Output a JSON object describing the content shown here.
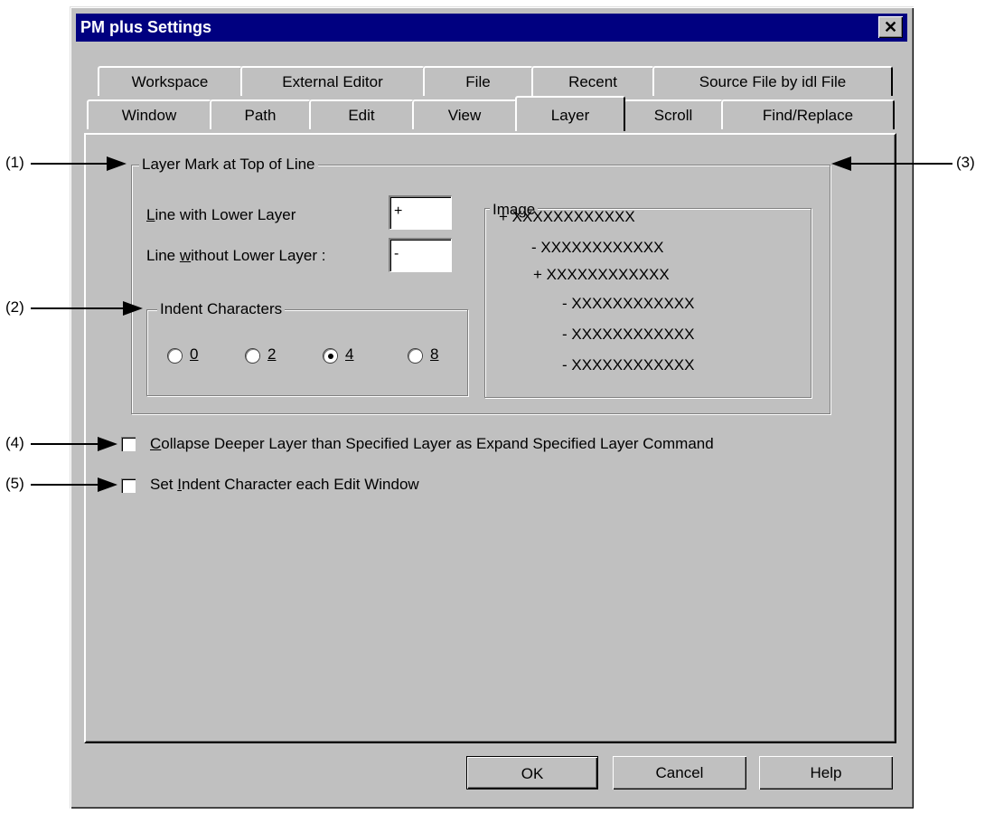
{
  "dialog": {
    "title": "PM plus Settings",
    "close_glyph": "✕"
  },
  "tabs_row1": [
    "Workspace",
    "External Editor",
    "File",
    "Recent",
    "Source File by idl File"
  ],
  "tabs_row2": [
    "Window",
    "Path",
    "Edit",
    "View",
    "Layer",
    "Scroll",
    "Find/Replace"
  ],
  "active_tab": "Layer",
  "layer_mark": {
    "legend": "Layer Mark at Top of Line",
    "lower_label_accel": "L",
    "lower_label_rest": "ine with Lower Layer",
    "lower_value": "+",
    "without_label_pre": "Line ",
    "without_label_accel": "w",
    "without_label_rest": "ithout Lower Layer :",
    "without_value": "-"
  },
  "indent": {
    "legend": "Indent Characters",
    "options": [
      "0",
      "2",
      "4",
      "8"
    ],
    "selected": "4"
  },
  "image": {
    "legend": "Image",
    "lines": [
      {
        "mark": "+",
        "text": "XXXXXXXXXXXX"
      },
      {
        "mark": "-",
        "text": "XXXXXXXXXXXX"
      },
      {
        "mark": "+",
        "text": "XXXXXXXXXXXX"
      },
      {
        "mark": "-",
        "text": "XXXXXXXXXXXX"
      },
      {
        "mark": "-",
        "text": "XXXXXXXXXXXX"
      },
      {
        "mark": "-",
        "text": "XXXXXXXXXXXX"
      }
    ]
  },
  "collapse": {
    "accel": "C",
    "rest": "ollapse Deeper Layer than Specified Layer as Expand Specified Layer Command",
    "checked": false
  },
  "set_indent": {
    "pre": "Set ",
    "accel": "I",
    "rest": "ndent Character each Edit Window",
    "checked": false
  },
  "buttons": {
    "ok": "OK",
    "cancel": "Cancel",
    "help": "Help"
  },
  "annotations": [
    "(1)",
    "(2)",
    "(3)",
    "(4)",
    "(5)"
  ],
  "colors": {
    "titlebar": "#000080",
    "face": "#c0c0c0"
  }
}
